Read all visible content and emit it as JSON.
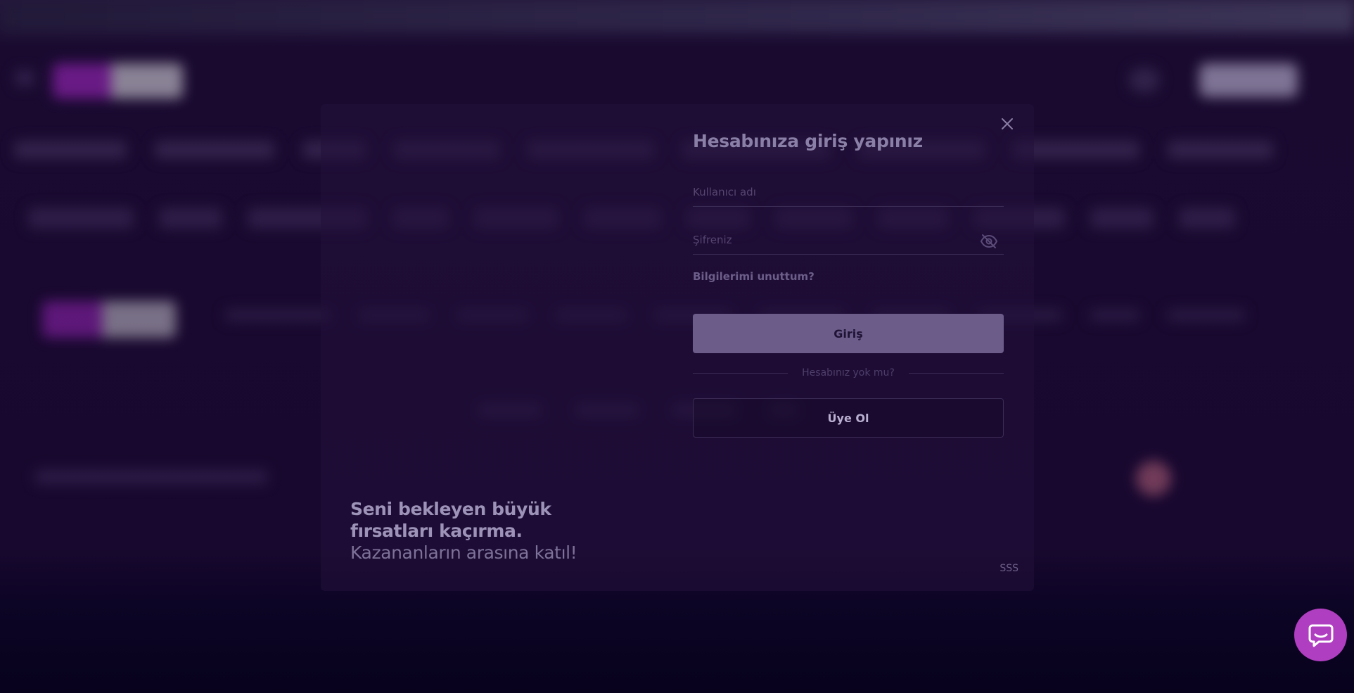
{
  "modal": {
    "title": "Hesabınıza giriş yapınız",
    "username_placeholder": "Kullanıcı adı",
    "password_placeholder": "Şifreniz",
    "forgot_label": "Bilgilerimi unuttum?",
    "submit_label": "Giriş",
    "no_account_label": "Hesabınız yok mu?",
    "register_label": "Üye Ol",
    "promo_line1": "Seni bekleyen büyük fırsatları kaçırma.",
    "promo_line2": "Kazananların arasına katıl!",
    "faq_label": "SSS"
  },
  "icons": {
    "close": "close-icon",
    "password_visibility": "eye-off-icon",
    "chat": "chat-bubble-icon"
  },
  "colors": {
    "background": "#1a0832",
    "primary_button": "#6c5c8a",
    "chat_button": "#b03ec0"
  }
}
